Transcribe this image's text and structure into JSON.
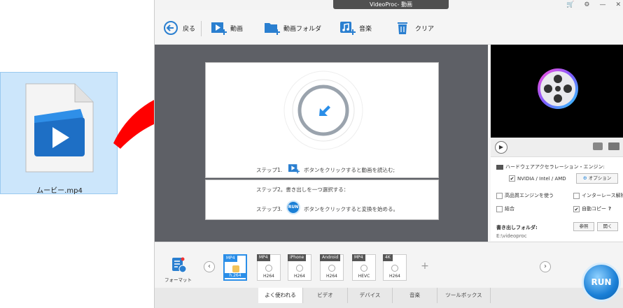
{
  "desktop": {
    "file_name": "ムービー.mp4"
  },
  "window": {
    "title": "VideoProc- 動画",
    "controls": [
      "🛒",
      "⚙",
      "—",
      "✕"
    ]
  },
  "toolbar": {
    "back": "戻る",
    "video": "動画",
    "video_folder": "動画フォルダ",
    "music": "音楽",
    "clear": "クリア"
  },
  "steps": {
    "step1_prefix": "ステップ1.",
    "step1_text": "ボタンをクリックすると動画を読込む;",
    "step2": "ステップ2。書き出しを一つ選択する：",
    "step3_prefix": "ステップ3.",
    "step3_text": "ボタンをクリックすると変換を始める。",
    "run_mini": "RUN"
  },
  "settings": {
    "hw_title": "ハードウェアアクセラレーション・エンジン:",
    "hw_value": "NVIDIA / Intel / AMD",
    "hw_checked": "✔",
    "option": "オプション",
    "hq_engine": "高品質エンジンを使う",
    "deinterlace": "インターレース解除",
    "merge": "結合",
    "auto_copy": "自動コピー",
    "auto_copy_checked": "✔",
    "help": "?",
    "output_label": "書き出しフォルダ:",
    "browse": "参照",
    "open": "開く",
    "output_path": "E:\\videoproc"
  },
  "formats": {
    "format_label": "フォーマット",
    "items": [
      {
        "top": "MP4",
        "codec": "h.264"
      },
      {
        "top": "MP4",
        "codec": "H264"
      },
      {
        "top": "iPhone",
        "codec": "H264"
      },
      {
        "top": "Android",
        "codec": "H264"
      },
      {
        "top": "MP4",
        "codec": "HEVC"
      },
      {
        "top": "4K",
        "codec": "H264"
      }
    ],
    "add": "+",
    "prev": "‹",
    "next": "›"
  },
  "tabs": [
    "よく使われる",
    "ビデオ",
    "デバイス",
    "音楽",
    "ツールボックス"
  ],
  "run_button": "RUN",
  "colors": {
    "accent": "#1a7fd6",
    "arrow": "#ff0000",
    "work_bg": "#5e6066"
  }
}
